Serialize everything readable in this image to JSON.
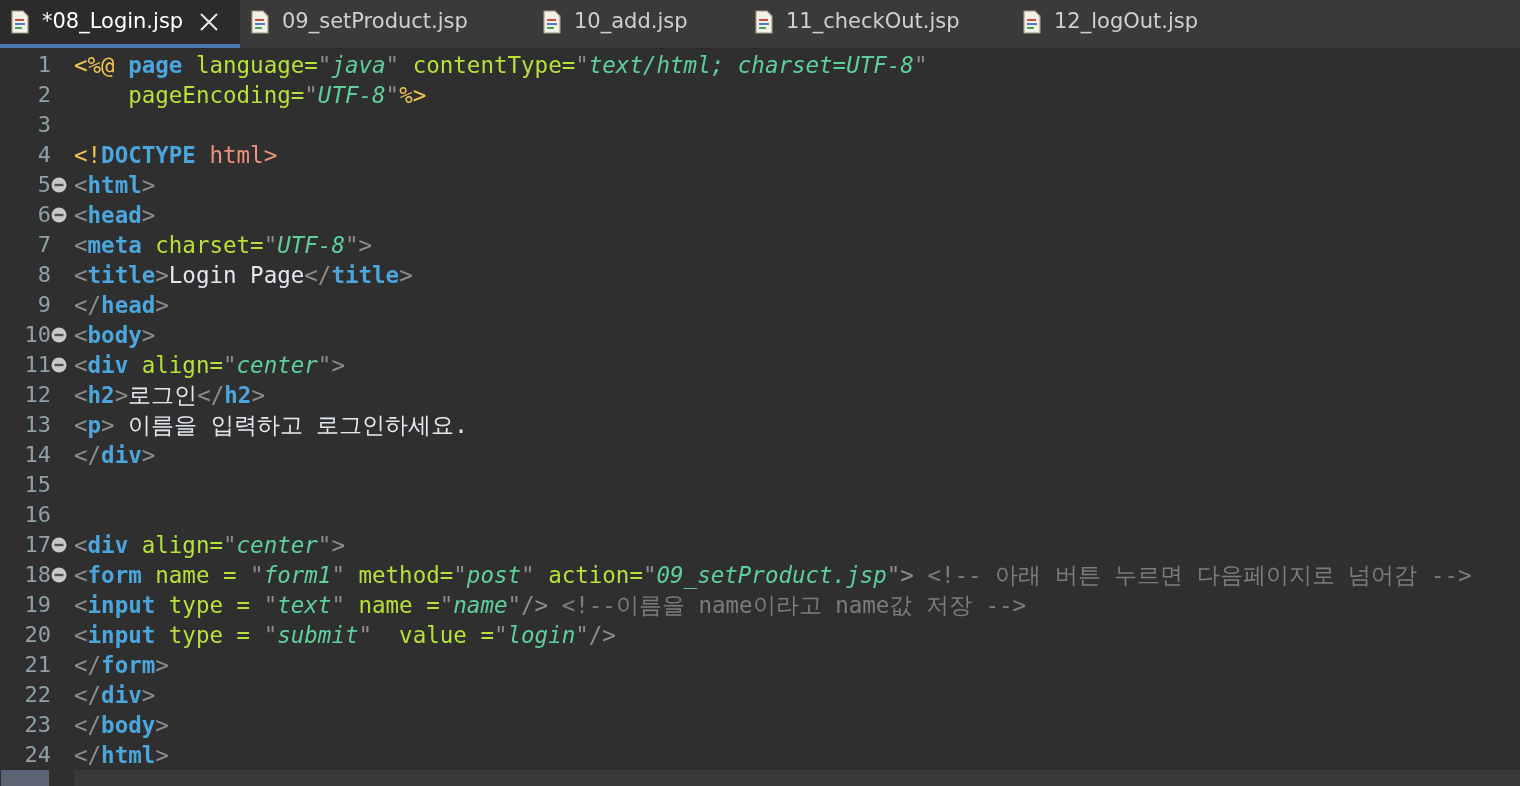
{
  "tabs": [
    {
      "label": "*08_Login.jsp",
      "selected": true
    },
    {
      "label": "09_setProduct.jsp",
      "selected": false
    },
    {
      "label": "10_add.jsp",
      "selected": false
    },
    {
      "label": "11_checkOut.jsp",
      "selected": false
    },
    {
      "label": "12_logOut.jsp",
      "selected": false
    }
  ],
  "lines": [
    {
      "number": "1",
      "foldable": false,
      "current": false,
      "tokens": [
        {
          "kind": "directive",
          "text": "<%@"
        },
        {
          "kind": "tag",
          "text": " page"
        },
        {
          "kind": "attr",
          "text": " language="
        },
        {
          "kind": "delim",
          "text": "\""
        },
        {
          "kind": "string",
          "text": "java"
        },
        {
          "kind": "delim",
          "text": "\""
        },
        {
          "kind": "attr",
          "text": " contentType="
        },
        {
          "kind": "delim",
          "text": "\""
        },
        {
          "kind": "string",
          "text": "text/html; charset=UTF-8"
        },
        {
          "kind": "delim",
          "text": "\""
        }
      ]
    },
    {
      "number": "2",
      "foldable": false,
      "current": false,
      "tokens": [
        {
          "kind": "attr",
          "text": "    pageEncoding="
        },
        {
          "kind": "delim",
          "text": "\""
        },
        {
          "kind": "string",
          "text": "UTF-8"
        },
        {
          "kind": "delim",
          "text": "\""
        },
        {
          "kind": "directive",
          "text": "%>"
        }
      ]
    },
    {
      "number": "3",
      "foldable": false,
      "current": false
    },
    {
      "number": "4",
      "foldable": false,
      "current": false,
      "tokens": [
        {
          "kind": "directive",
          "text": "<!"
        },
        {
          "kind": "tag",
          "text": "DOCTYPE"
        },
        {
          "kind": "doctype",
          "text": " html>"
        }
      ]
    },
    {
      "number": "5",
      "foldable": true,
      "current": false,
      "tokens": [
        {
          "kind": "delim",
          "text": "<"
        },
        {
          "kind": "tag",
          "text": "html"
        },
        {
          "kind": "delim",
          "text": ">"
        }
      ]
    },
    {
      "number": "6",
      "foldable": true,
      "current": false,
      "tokens": [
        {
          "kind": "delim",
          "text": "<"
        },
        {
          "kind": "tag",
          "text": "head"
        },
        {
          "kind": "delim",
          "text": ">"
        }
      ]
    },
    {
      "number": "7",
      "foldable": false,
      "current": false,
      "tokens": [
        {
          "kind": "delim",
          "text": "<"
        },
        {
          "kind": "tag",
          "text": "meta"
        },
        {
          "kind": "attr",
          "text": " charset="
        },
        {
          "kind": "delim",
          "text": "\""
        },
        {
          "kind": "string",
          "text": "UTF-8"
        },
        {
          "kind": "delim",
          "text": "\">"
        }
      ]
    },
    {
      "number": "8",
      "foldable": false,
      "current": false,
      "tokens": [
        {
          "kind": "delim",
          "text": "<"
        },
        {
          "kind": "tag",
          "text": "title"
        },
        {
          "kind": "delim",
          "text": ">"
        },
        {
          "kind": "plain",
          "text": "Login Page"
        },
        {
          "kind": "delim",
          "text": "</"
        },
        {
          "kind": "tag",
          "text": "title"
        },
        {
          "kind": "delim",
          "text": ">"
        }
      ]
    },
    {
      "number": "9",
      "foldable": false,
      "current": false,
      "tokens": [
        {
          "kind": "delim",
          "text": "</"
        },
        {
          "kind": "tag",
          "text": "head"
        },
        {
          "kind": "delim",
          "text": ">"
        }
      ]
    },
    {
      "number": "10",
      "foldable": true,
      "current": false,
      "tokens": [
        {
          "kind": "delim",
          "text": "<"
        },
        {
          "kind": "tag",
          "text": "body"
        },
        {
          "kind": "delim",
          "text": ">"
        }
      ]
    },
    {
      "number": "11",
      "foldable": true,
      "current": false,
      "tokens": [
        {
          "kind": "delim",
          "text": "<"
        },
        {
          "kind": "tag",
          "text": "div"
        },
        {
          "kind": "attr",
          "text": " align="
        },
        {
          "kind": "delim",
          "text": "\""
        },
        {
          "kind": "string",
          "text": "center"
        },
        {
          "kind": "delim",
          "text": "\">"
        }
      ]
    },
    {
      "number": "12",
      "foldable": false,
      "current": false,
      "tokens": [
        {
          "kind": "delim",
          "text": "<"
        },
        {
          "kind": "tag",
          "text": "h2"
        },
        {
          "kind": "delim",
          "text": ">"
        },
        {
          "kind": "plain",
          "text": "로그인"
        },
        {
          "kind": "delim",
          "text": "</"
        },
        {
          "kind": "tag",
          "text": "h2"
        },
        {
          "kind": "delim",
          "text": ">"
        }
      ]
    },
    {
      "number": "13",
      "foldable": false,
      "current": false,
      "tokens": [
        {
          "kind": "delim",
          "text": "<"
        },
        {
          "kind": "tag",
          "text": "p"
        },
        {
          "kind": "delim",
          "text": ">"
        },
        {
          "kind": "plain",
          "text": " 이름을 입력하고 로그인하세요."
        }
      ]
    },
    {
      "number": "14",
      "foldable": false,
      "current": false,
      "tokens": [
        {
          "kind": "delim",
          "text": "</"
        },
        {
          "kind": "tag",
          "text": "div"
        },
        {
          "kind": "delim",
          "text": ">"
        }
      ]
    },
    {
      "number": "15",
      "foldable": false,
      "current": false
    },
    {
      "number": "16",
      "foldable": false,
      "current": false
    },
    {
      "number": "17",
      "foldable": true,
      "current": false,
      "tokens": [
        {
          "kind": "delim",
          "text": "<"
        },
        {
          "kind": "tag",
          "text": "div"
        },
        {
          "kind": "attr",
          "text": " align="
        },
        {
          "kind": "delim",
          "text": "\""
        },
        {
          "kind": "string",
          "text": "center"
        },
        {
          "kind": "delim",
          "text": "\">"
        }
      ]
    },
    {
      "number": "18",
      "foldable": true,
      "current": false,
      "tokens": [
        {
          "kind": "delim",
          "text": "<"
        },
        {
          "kind": "tag",
          "text": "form"
        },
        {
          "kind": "attr",
          "text": " name = "
        },
        {
          "kind": "delim",
          "text": "\""
        },
        {
          "kind": "string",
          "text": "form1"
        },
        {
          "kind": "delim",
          "text": "\""
        },
        {
          "kind": "attr",
          "text": " method="
        },
        {
          "kind": "delim",
          "text": "\""
        },
        {
          "kind": "string",
          "text": "post"
        },
        {
          "kind": "delim",
          "text": "\""
        },
        {
          "kind": "attr",
          "text": " action="
        },
        {
          "kind": "delim",
          "text": "\""
        },
        {
          "kind": "string",
          "text": "09_setProduct.jsp"
        },
        {
          "kind": "delim",
          "text": "\">"
        },
        {
          "kind": "comment",
          "text": " <!-- 아래 버튼 누르면 다음페이지로 넘어감 -->"
        }
      ]
    },
    {
      "number": "19",
      "foldable": false,
      "current": false,
      "tokens": [
        {
          "kind": "delim",
          "text": "<"
        },
        {
          "kind": "tag",
          "text": "input"
        },
        {
          "kind": "attr",
          "text": " type = "
        },
        {
          "kind": "delim",
          "text": "\""
        },
        {
          "kind": "string",
          "text": "text"
        },
        {
          "kind": "delim",
          "text": "\""
        },
        {
          "kind": "attr",
          "text": " name ="
        },
        {
          "kind": "delim",
          "text": "\""
        },
        {
          "kind": "string",
          "text": "name"
        },
        {
          "kind": "delim",
          "text": "\"/>"
        },
        {
          "kind": "comment",
          "text": " <!--이름을 name이라고 name값 저장 -->"
        }
      ]
    },
    {
      "number": "20",
      "foldable": false,
      "current": false,
      "tokens": [
        {
          "kind": "delim",
          "text": "<"
        },
        {
          "kind": "tag",
          "text": "input"
        },
        {
          "kind": "attr",
          "text": " type = "
        },
        {
          "kind": "delim",
          "text": "\""
        },
        {
          "kind": "string",
          "text": "submit"
        },
        {
          "kind": "delim",
          "text": "\""
        },
        {
          "kind": "attr",
          "text": "  value ="
        },
        {
          "kind": "delim",
          "text": "\""
        },
        {
          "kind": "string",
          "text": "login"
        },
        {
          "kind": "delim",
          "text": "\"/>"
        }
      ]
    },
    {
      "number": "21",
      "foldable": false,
      "current": false,
      "tokens": [
        {
          "kind": "delim",
          "text": "</"
        },
        {
          "kind": "tag",
          "text": "form"
        },
        {
          "kind": "delim",
          "text": ">"
        }
      ]
    },
    {
      "number": "22",
      "foldable": false,
      "current": false,
      "tokens": [
        {
          "kind": "delim",
          "text": "</"
        },
        {
          "kind": "tag",
          "text": "div"
        },
        {
          "kind": "delim",
          "text": ">"
        }
      ]
    },
    {
      "number": "23",
      "foldable": false,
      "current": false,
      "tokens": [
        {
          "kind": "delim",
          "text": "</"
        },
        {
          "kind": "tag",
          "text": "body"
        },
        {
          "kind": "delim",
          "text": ">"
        }
      ]
    },
    {
      "number": "24",
      "foldable": false,
      "current": false,
      "tokens": [
        {
          "kind": "delim",
          "text": "</"
        },
        {
          "kind": "tag",
          "text": "html"
        },
        {
          "kind": "delim",
          "text": ">"
        }
      ]
    },
    {
      "foldable": false,
      "current": true
    }
  ]
}
